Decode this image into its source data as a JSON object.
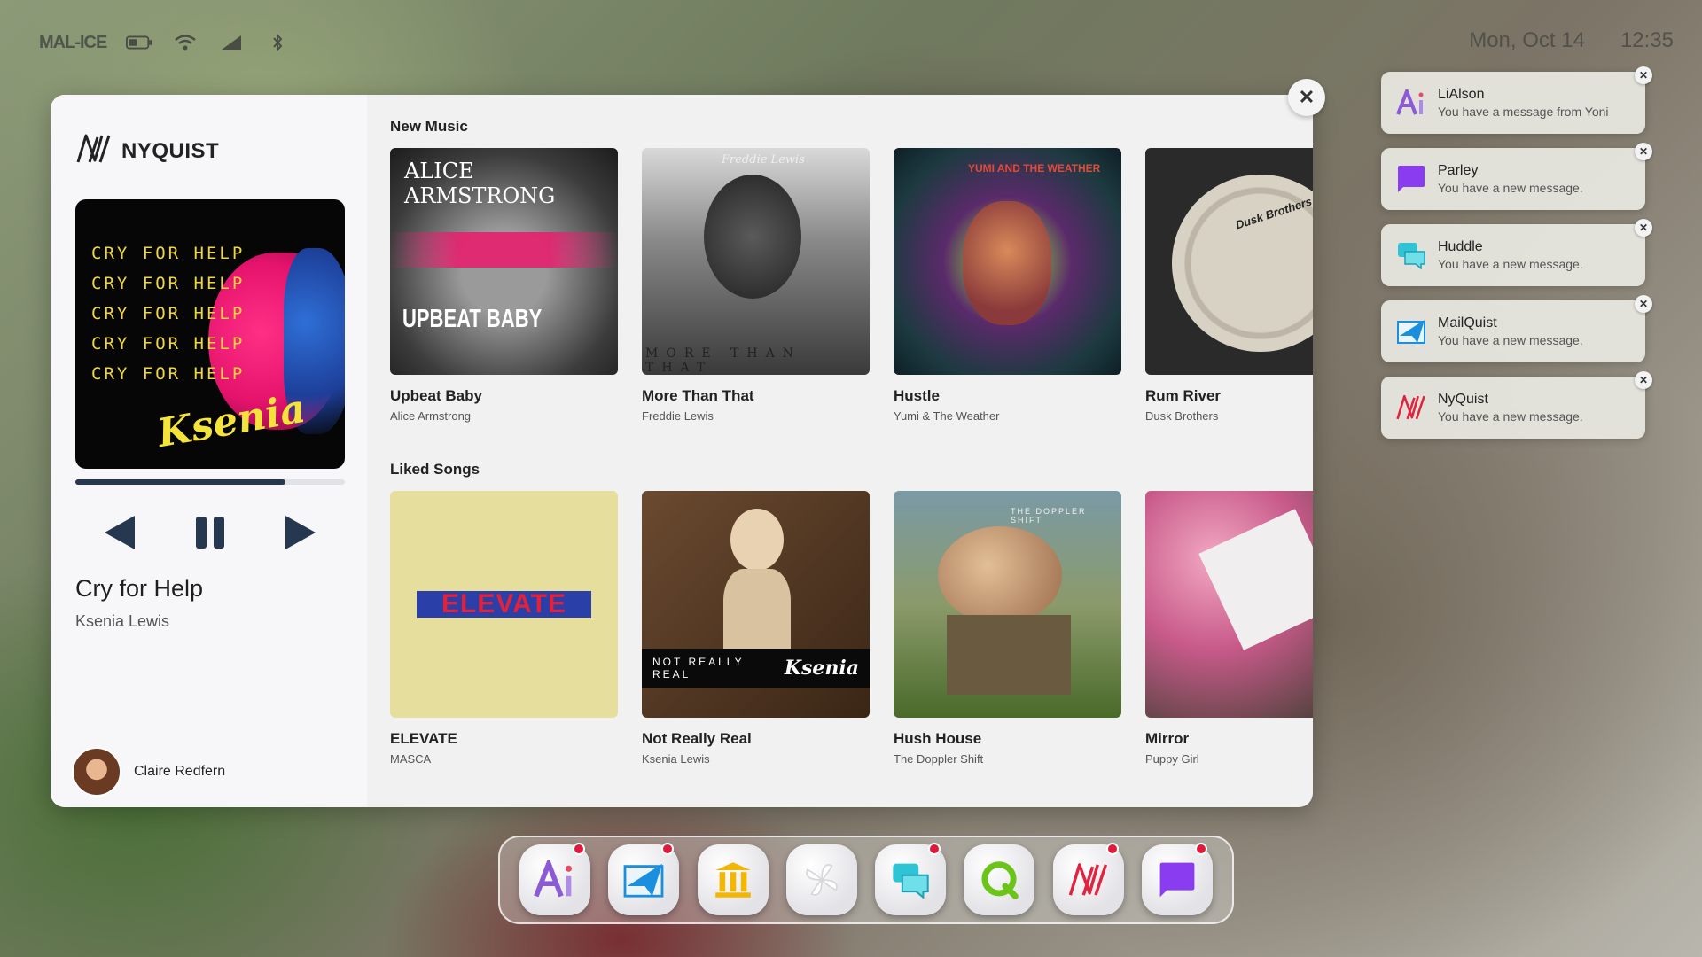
{
  "status": {
    "carrier": "MAL-ICE",
    "date": "Mon, Oct 14",
    "time": "12:35"
  },
  "app": {
    "name": "NYQUIST",
    "now_playing": {
      "cover_lines": [
        "CRY FOR HELP",
        "CRY FOR HELP",
        "CRY FOR HELP",
        "CRY FOR HELP",
        "CRY FOR HELP"
      ],
      "cover_signature": "Ksenia",
      "title": "Cry for Help",
      "artist": "Ksenia Lewis",
      "progress_fraction": 0.78
    },
    "user": {
      "name": "Claire Redfern"
    }
  },
  "sections": {
    "new_music": {
      "title": "New Music",
      "items": [
        {
          "title": "Upbeat Baby",
          "artist": "Alice Armstrong",
          "cover_top": "ALICE ARMSTRONG",
          "cover_bottom": "UPBEAT BABY"
        },
        {
          "title": "More Than That",
          "artist": "Freddie Lewis",
          "cover_top": "Freddie Lewis",
          "cover_bottom": "MORE THAN THAT"
        },
        {
          "title": "Hustle",
          "artist": "Yumi & The Weather",
          "cover_top": "YUMI AND THE WEATHER"
        },
        {
          "title": "Rum River",
          "artist": "Dusk Brothers",
          "cover_top": "Dusk Brothers"
        }
      ]
    },
    "liked_songs": {
      "title": "Liked Songs",
      "items": [
        {
          "title": "ELEVATE",
          "artist": "MASCA",
          "cover_top": "ELEVATE"
        },
        {
          "title": "Not Really Real",
          "artist": "Ksenia Lewis",
          "cover_bottom": "NOT REALLY REAL",
          "cover_signature": "Ksenia"
        },
        {
          "title": "Hush House",
          "artist": "The Doppler Shift",
          "cover_top": "THE DOPPLER SHIFT"
        },
        {
          "title": "Mirror",
          "artist": "Puppy Girl"
        }
      ]
    }
  },
  "notifications": [
    {
      "app": "LiAlson",
      "message": "You have a message from Yoni",
      "icon": "lialson-icon"
    },
    {
      "app": "Parley",
      "message": "You have a new message.",
      "icon": "parley-icon"
    },
    {
      "app": "Huddle",
      "message": "You have a new message.",
      "icon": "huddle-icon"
    },
    {
      "app": "MailQuist",
      "message": "You have a new message.",
      "icon": "mailquist-icon"
    },
    {
      "app": "NyQuist",
      "message": "You have a new message.",
      "icon": "nyquist-icon"
    }
  ],
  "dock": [
    {
      "icon": "lialson-icon",
      "badge": true
    },
    {
      "icon": "mailquist-icon",
      "badge": true
    },
    {
      "icon": "bank-icon",
      "badge": false
    },
    {
      "icon": "pinwheel-icon",
      "badge": false
    },
    {
      "icon": "huddle-icon",
      "badge": true
    },
    {
      "icon": "q-icon",
      "badge": false
    },
    {
      "icon": "nyquist-icon",
      "badge": true
    },
    {
      "icon": "parley-icon",
      "badge": true
    }
  ],
  "colors": {
    "accent": "#263850",
    "badge": "#e01a3b",
    "nyquist_red": "#e0243f",
    "parley_purple": "#8a3cf0",
    "huddle_teal": "#2ec4d6",
    "mailquist_blue": "#1a8fe0",
    "lialson_violet": "#8b5bd6"
  }
}
